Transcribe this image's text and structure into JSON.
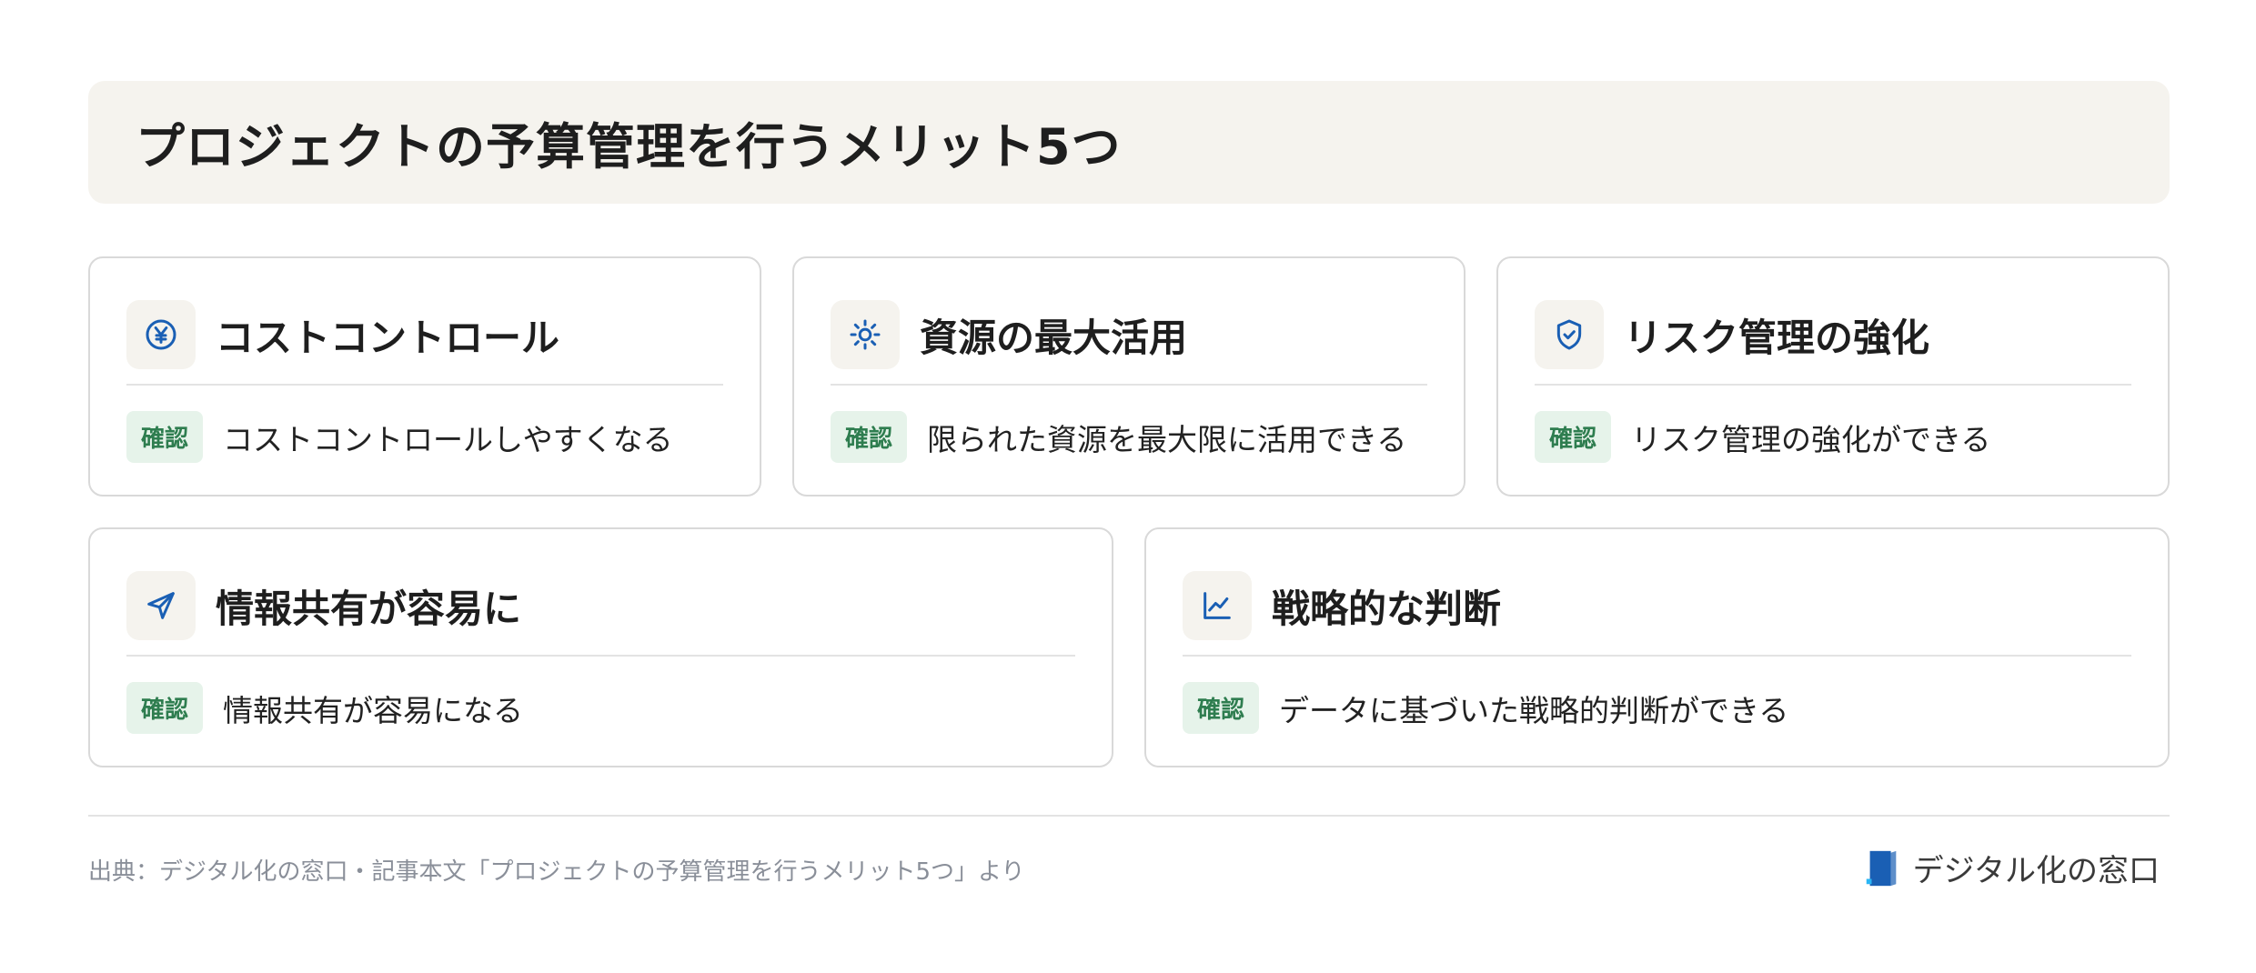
{
  "header": {
    "title": "プロジェクトの予算管理を行うメリット5つ"
  },
  "cards": [
    {
      "icon": "yen-circle-icon",
      "title": "コストコントロール",
      "badge": "確認",
      "description": "コストコントロールしやすくなる"
    },
    {
      "icon": "sun-gear-icon",
      "title": "資源の最大活用",
      "badge": "確認",
      "description": "限られた資源を最大限に活用できる"
    },
    {
      "icon": "shield-check-icon",
      "title": "リスク管理の強化",
      "badge": "確認",
      "description": "リスク管理の強化ができる"
    },
    {
      "icon": "send-plane-icon",
      "title": "情報共有が容易に",
      "badge": "確認",
      "description": "情報共有が容易になる"
    },
    {
      "icon": "line-chart-icon",
      "title": "戦略的な判断",
      "badge": "確認",
      "description": "データに基づいた戦略的判断ができる"
    }
  ],
  "footer": {
    "source": "出典：デジタル化の窓口・記事本文「プロジェクトの予算管理を行うメリット5つ」より",
    "brand_name": "デジタル化の窓口"
  },
  "colors": {
    "accent": "#1a5fb4",
    "badge_bg": "#e6f3ea",
    "badge_text": "#2e7d4f",
    "title_bg": "#f5f3ee"
  }
}
